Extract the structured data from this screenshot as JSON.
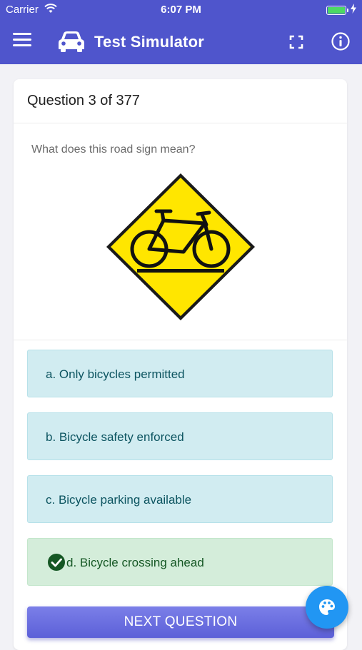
{
  "status_bar": {
    "carrier": "Carrier",
    "time": "6:07 PM",
    "wifi_icon": "wifi-icon",
    "battery_icon": "battery-icon"
  },
  "app_bar": {
    "title": "Test Simulator",
    "menu_icon": "hamburger-menu-icon",
    "logo_icon": "car-icon",
    "fullscreen_icon": "fullscreen-icon",
    "info_icon": "info-icon",
    "color": "#4f55cc"
  },
  "question": {
    "header": "Question 3 of 377",
    "text": "What does this road sign mean?",
    "image": "bicycle-crossing-sign-icon",
    "options": [
      {
        "label": "a. Only bicycles permitted",
        "state": "default"
      },
      {
        "label": "b. Bicycle safety enforced",
        "state": "default"
      },
      {
        "label": "c. Bicycle parking available",
        "state": "default"
      },
      {
        "label": "d. Bicycle crossing ahead",
        "state": "correct"
      }
    ]
  },
  "actions": {
    "next_label": "NEXT QUESTION",
    "theme_icon": "palette-icon"
  },
  "colors": {
    "option_bg": "#d1ecf1",
    "correct_bg": "#d4edda",
    "fab": "#2196f3"
  }
}
